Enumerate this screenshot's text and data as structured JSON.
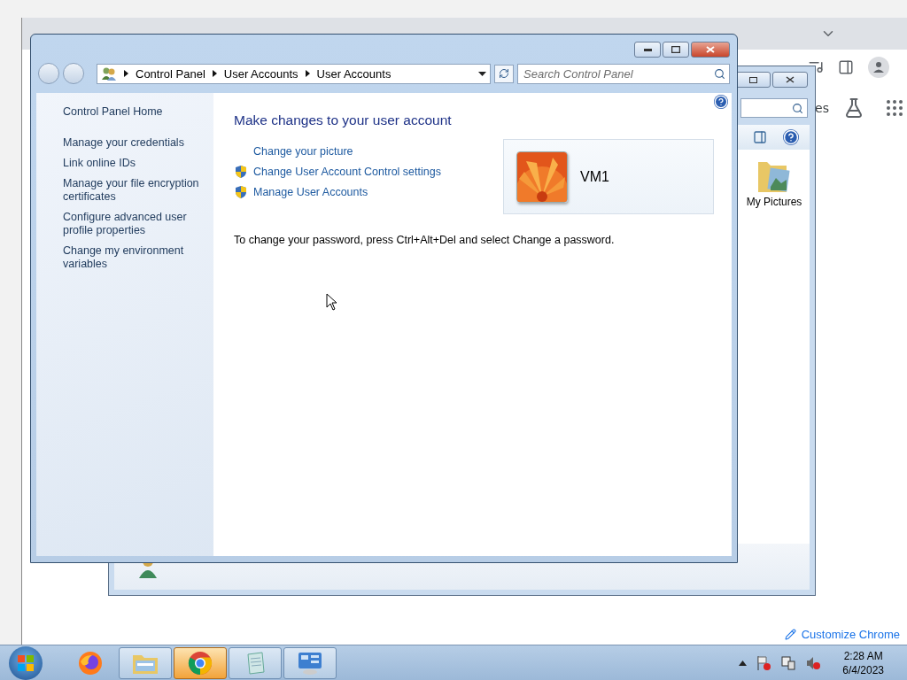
{
  "browser": {
    "partial_text": "es",
    "customize_button": "Customize Chrome"
  },
  "explorer": {
    "items": [
      {
        "label": "My Pictures"
      }
    ]
  },
  "control_panel": {
    "breadcrumb": [
      "Control Panel",
      "User Accounts",
      "User Accounts"
    ],
    "search": {
      "placeholder": "Search Control Panel"
    },
    "sidebar": {
      "home": "Control Panel Home",
      "items": [
        "Manage your credentials",
        "Link online IDs",
        "Manage your file encryption certificates",
        "Configure advanced user profile properties",
        "Change my environment variables"
      ]
    },
    "heading": "Make changes to your user account",
    "tasks": [
      {
        "label": "Change your picture",
        "shield": false
      },
      {
        "label": "Change User Account Control settings",
        "shield": true
      },
      {
        "label": "Manage User Accounts",
        "shield": true
      }
    ],
    "account": {
      "name": "VM1"
    },
    "note": "To change your password, press Ctrl+Alt+Del and select Change a password."
  },
  "taskbar": {
    "apps": [
      {
        "kind": "firefox",
        "running": false,
        "selected": false
      },
      {
        "kind": "explorer",
        "running": true,
        "selected": false
      },
      {
        "kind": "chrome",
        "running": true,
        "selected": true
      },
      {
        "kind": "notepad",
        "running": true,
        "selected": false
      },
      {
        "kind": "controlpanel",
        "running": true,
        "selected": false
      }
    ],
    "clock": {
      "time": "2:28 AM",
      "date": "6/4/2023"
    }
  }
}
